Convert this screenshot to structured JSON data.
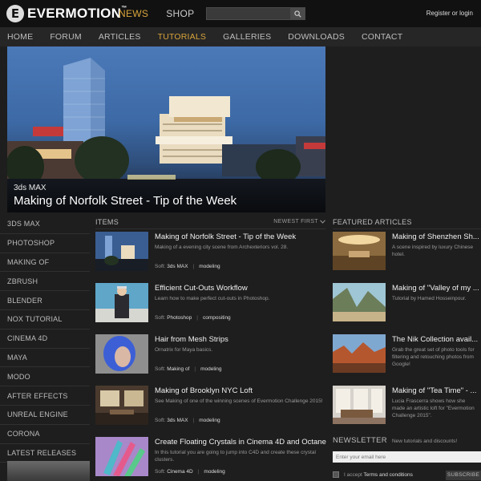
{
  "brand": {
    "name": "EVERMOTION",
    "tm": "™",
    "mark": "E"
  },
  "top_nav": [
    "NEWS",
    "SHOP"
  ],
  "search": {
    "placeholder": ""
  },
  "login": "Register or login",
  "main_nav": [
    "HOME",
    "FORUM",
    "ARTICLES",
    "TUTORIALS",
    "GALLERIES",
    "DOWNLOADS",
    "CONTACT"
  ],
  "hero": {
    "category": "3ds MAX",
    "title": "Making of Norfolk Street - Tip of the Week"
  },
  "sidebar": [
    "3DS MAX",
    "PHOTOSHOP",
    "MAKING OF",
    "ZBRUSH",
    "BLENDER",
    "NOX TUTORIAL",
    "CINEMA 4D",
    "MAYA",
    "MODO",
    "AFTER EFFECTS",
    "UNREAL ENGINE",
    "CORONA",
    "LATEST RELEASES"
  ],
  "items_header": "ITEMS",
  "sort_label": "NEWEST FIRST",
  "items": [
    {
      "title": "Making of Norfolk Street - Tip of the Week",
      "desc": "Making of a evening city scene from Archexteriors vol. 28.",
      "soft_label": "Soft:",
      "soft": "3ds MAX",
      "tag": "modeling"
    },
    {
      "title": "Efficient Cut-Outs Workflow",
      "desc": "Learn how to make perfect cut-outs in Photoshop.",
      "soft_label": "Soft:",
      "soft": "Photoshop",
      "tag": "compositing"
    },
    {
      "title": "Hair from Mesh Strips",
      "desc": "Ornatrix for Maya basics.",
      "soft_label": "Soft:",
      "soft": "Making of",
      "tag": "modeling"
    },
    {
      "title": "Making of Brooklyn NYC Loft",
      "desc": "See Making of one of the winning scenes of Evermotion Challenge 2015!",
      "soft_label": "Soft:",
      "soft": "3ds MAX",
      "tag": "modeling"
    },
    {
      "title": "Create Floating Crystals in Cinema 4D and Octane",
      "desc": "In this tutorial you are going to jump into C4D and create these crystal clusters.",
      "soft_label": "Soft:",
      "soft": "Cinema 4D",
      "tag": "modeling"
    }
  ],
  "featured_header": "FEATURED ARTICLES",
  "featured": [
    {
      "title": "Making of Shenzhen Sh...",
      "desc": "A scene inspired by luxury Chinese hotel."
    },
    {
      "title": "Making of \"Valley of my ...",
      "desc": "Tutorial by Hamed Hosseinpour."
    },
    {
      "title": "The Nik Collection avail...",
      "desc": "Grab the great set of photo tools for filtering and retouching photos from Google!"
    },
    {
      "title": "Making of \"Tea Time\" - ...",
      "desc": "Lucia Frascerra shows how she made an artistic loft for \"Evermotion Challenge 2015\"."
    }
  ],
  "newsletter": {
    "title": "NEWSLETTER",
    "subtitle": "New tutorials and discounts!",
    "placeholder": "Enter your email here",
    "accept_prefix": "I accept",
    "accept_link": "Terms and conditions",
    "subscribe": "SUBSCRIBE"
  },
  "colors": {
    "accent": "#d8a43a",
    "background": "#1e1e1e",
    "topbar": "#111111"
  },
  "icons": {
    "search": "search-icon",
    "sort": "chevron-down-icon",
    "logo": "evermotion-logo-icon"
  }
}
